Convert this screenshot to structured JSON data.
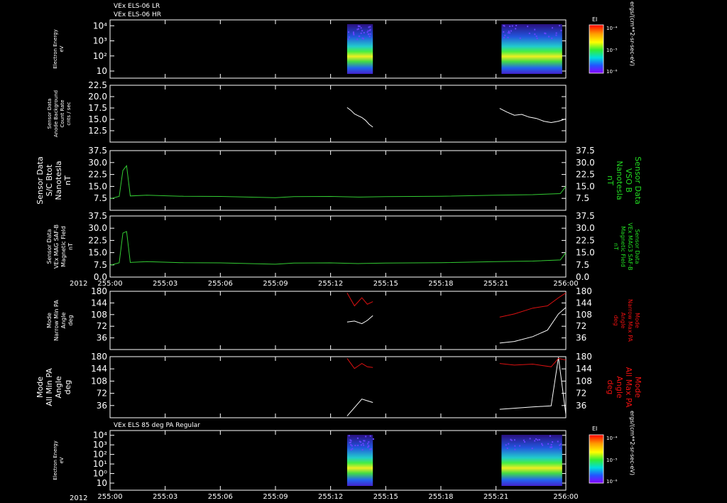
{
  "titles": [
    "VEx ELS-06 LR",
    "VEx ELS-06 HR"
  ],
  "lower_title": "VEx ELS 85 deg PA Regular",
  "year_label": "2012",
  "time_ticks": [
    "255:00",
    "255:03",
    "255:06",
    "255:09",
    "255:12",
    "255:15",
    "255:18",
    "255:21",
    "256:00"
  ],
  "colorbar": {
    "title": "EI",
    "tick_labels": [
      "10⁻⁴",
      "10⁻⁵",
      "10⁻⁶"
    ],
    "unit_label": "ergs/(cm**2-sr-sec-eV)"
  },
  "colors": {
    "background": "#000000",
    "foreground": "#ffffff",
    "green": "#33cc33",
    "red": "#dd1111",
    "right_label_green": "#22dd22",
    "right_label_red": "#ee1111"
  },
  "chart_data": [
    {
      "type": "heatmap",
      "ylabel": [
        "Electron Energy",
        "eV"
      ],
      "y_tick_labels": [
        "10",
        "10²",
        "10³",
        "10⁴"
      ],
      "y_scale": "log",
      "ylim": [
        1,
        20000
      ],
      "x": [
        "255:00",
        "256:00"
      ],
      "data_intervals": [
        [
          "255:12.8",
          "255:14.4"
        ],
        [
          "255:21.2",
          "255:24.8"
        ]
      ],
      "colorbar": "EI"
    },
    {
      "type": "line",
      "ylabel": [
        "Sensor Data",
        "Anode Background",
        "Count Rate",
        "cnts / sec"
      ],
      "y_tick_labels": [
        "12.5",
        "15.0",
        "17.5",
        "20.0",
        "22.5"
      ],
      "ylim": [
        10.0,
        22.5
      ],
      "series": [
        {
          "color": "white",
          "values": [
            [
              12.9,
              17.6
            ],
            [
              13.1,
              17.0
            ],
            [
              13.3,
              16.2
            ],
            [
              13.5,
              15.8
            ],
            [
              13.7,
              15.4
            ],
            [
              13.9,
              14.8
            ],
            [
              14.1,
              13.9
            ],
            [
              14.3,
              13.3
            ]
          ]
        },
        {
          "color": "white",
          "values": [
            [
              21.2,
              17.4
            ],
            [
              21.6,
              16.6
            ],
            [
              22.0,
              15.9
            ],
            [
              22.4,
              16.1
            ],
            [
              22.8,
              15.5
            ],
            [
              23.2,
              15.2
            ],
            [
              23.6,
              14.6
            ],
            [
              24.0,
              14.3
            ],
            [
              24.4,
              14.6
            ],
            [
              24.8,
              15.1
            ]
          ]
        }
      ]
    },
    {
      "type": "line",
      "ylabel": [
        "Sensor Data",
        "S/C Btot",
        "Nanotesla",
        "nT"
      ],
      "ylabel_right": [
        "Sensor Data",
        "VSO B",
        "Nanotesla",
        "nT"
      ],
      "y_tick_labels": [
        "7.5",
        "15.0",
        "22.5",
        "30.0",
        "37.5"
      ],
      "ylim": [
        0,
        37.5
      ],
      "series": [
        {
          "color": "green",
          "values": [
            [
              0.0,
              7.2
            ],
            [
              0.5,
              8.8
            ],
            [
              0.7,
              25.0
            ],
            [
              0.9,
              28.0
            ],
            [
              1.1,
              9.0
            ],
            [
              2.0,
              9.5
            ],
            [
              4.0,
              8.8
            ],
            [
              6.0,
              8.7
            ],
            [
              9.0,
              7.9
            ],
            [
              10.0,
              8.6
            ],
            [
              12.0,
              8.7
            ],
            [
              13.5,
              8.3
            ],
            [
              15.0,
              8.6
            ],
            [
              18.0,
              8.8
            ],
            [
              21.0,
              9.5
            ],
            [
              23.0,
              9.8
            ],
            [
              24.5,
              10.5
            ],
            [
              24.8,
              15.0
            ]
          ]
        }
      ]
    },
    {
      "type": "line",
      "ylabel": [
        "Sensor Data",
        "VEx MAG SAF-B",
        "Magnetic Field",
        "nT"
      ],
      "ylabel_right": [
        "Sensor Data",
        "VEx MAG3 SAF-B",
        "Magnetic Field",
        "nT"
      ],
      "y_tick_labels": [
        "0.0",
        "7.5",
        "15.0",
        "22.5",
        "30.0",
        "37.5"
      ],
      "ylim": [
        0,
        37.5
      ],
      "series": [
        {
          "color": "green",
          "values": [
            [
              0.0,
              7.2
            ],
            [
              0.5,
              8.8
            ],
            [
              0.7,
              27.0
            ],
            [
              0.9,
              28.0
            ],
            [
              1.1,
              9.0
            ],
            [
              2.0,
              9.5
            ],
            [
              4.0,
              8.8
            ],
            [
              6.0,
              8.7
            ],
            [
              9.0,
              7.9
            ],
            [
              10.0,
              8.6
            ],
            [
              12.0,
              8.7
            ],
            [
              13.5,
              8.3
            ],
            [
              15.0,
              8.6
            ],
            [
              18.0,
              8.8
            ],
            [
              21.0,
              9.5
            ],
            [
              23.0,
              9.8
            ],
            [
              24.5,
              10.5
            ],
            [
              24.8,
              15.0
            ]
          ]
        }
      ]
    },
    {
      "type": "line",
      "ylabel": [
        "Mode",
        "Narrow Min PA",
        "Angle",
        "deg"
      ],
      "ylabel_right": [
        "Mode",
        "Narrow Max PA",
        "Angle",
        "deg"
      ],
      "y_tick_labels": [
        "36",
        "72",
        "108",
        "144",
        "180"
      ],
      "ylim": [
        0,
        180
      ],
      "series": [
        {
          "color": "white",
          "values": [
            [
              12.9,
              85
            ],
            [
              13.3,
              88
            ],
            [
              13.7,
              80
            ],
            [
              14.0,
              90
            ],
            [
              14.3,
              105
            ]
          ]
        },
        {
          "color": "red",
          "values": [
            [
              12.9,
              175
            ],
            [
              13.3,
              135
            ],
            [
              13.7,
              160
            ],
            [
              14.0,
              140
            ],
            [
              14.3,
              148
            ]
          ]
        },
        {
          "color": "white",
          "values": [
            [
              21.2,
              20
            ],
            [
              22.0,
              25
            ],
            [
              23.0,
              40
            ],
            [
              23.8,
              60
            ],
            [
              24.4,
              110
            ],
            [
              24.8,
              130
            ]
          ]
        },
        {
          "color": "red",
          "values": [
            [
              21.2,
              100
            ],
            [
              22.0,
              110
            ],
            [
              23.0,
              128
            ],
            [
              23.8,
              135
            ],
            [
              24.4,
              160
            ],
            [
              24.8,
              175
            ]
          ]
        }
      ]
    },
    {
      "type": "line",
      "ylabel": [
        "Mode",
        "All Min PA",
        "Angle",
        "deg"
      ],
      "ylabel_right": [
        "Mode",
        "All Max PA",
        "Angle",
        "deg"
      ],
      "y_tick_labels": [
        "36",
        "72",
        "108",
        "144",
        "180"
      ],
      "ylim": [
        0,
        180
      ],
      "series": [
        {
          "color": "white",
          "values": [
            [
              12.9,
              5
            ],
            [
              13.3,
              30
            ],
            [
              13.7,
              55
            ],
            [
              14.0,
              50
            ],
            [
              14.3,
              45
            ]
          ]
        },
        {
          "color": "red",
          "values": [
            [
              12.9,
              175
            ],
            [
              13.3,
              145
            ],
            [
              13.7,
              160
            ],
            [
              14.0,
              150
            ],
            [
              14.3,
              148
            ]
          ]
        },
        {
          "color": "white",
          "values": [
            [
              21.2,
              25
            ],
            [
              22.0,
              28
            ],
            [
              23.0,
              32
            ],
            [
              24.0,
              35
            ],
            [
              24.4,
              178
            ],
            [
              24.8,
              10
            ]
          ]
        },
        {
          "color": "red",
          "values": [
            [
              21.2,
              160
            ],
            [
              22.0,
              155
            ],
            [
              23.0,
              158
            ],
            [
              24.0,
              150
            ],
            [
              24.4,
              175
            ],
            [
              24.8,
              170
            ]
          ]
        }
      ]
    },
    {
      "type": "heatmap",
      "ylabel": [
        "Electron Energy",
        "eV"
      ],
      "y_tick_labels": [
        "10",
        "10⁰",
        "10¹",
        "10²",
        "10³",
        "10⁴"
      ],
      "y_scale": "log",
      "ylim": [
        0.1,
        20000
      ],
      "x": [
        "255:00",
        "256:00"
      ],
      "data_intervals": [
        [
          "255:12.8",
          "255:14.4"
        ],
        [
          "255:21.2",
          "255:24.8"
        ]
      ],
      "colorbar": "EI"
    }
  ]
}
